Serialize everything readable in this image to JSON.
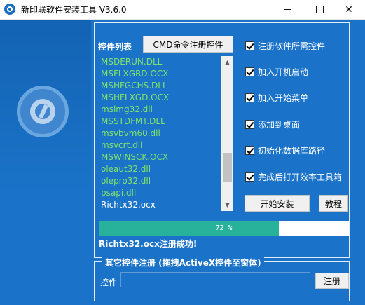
{
  "window": {
    "title": "新印联软件安装工具 V3.6.0",
    "min_icon": "minimize-icon",
    "max_icon": "maximize-icon",
    "close_icon": "close-icon"
  },
  "colors": {
    "panel_bg": "#1a73c8",
    "pending_item": "#7fe36a",
    "done_item": "#ffffff",
    "progress_fill": "#28b29c"
  },
  "controls_list": {
    "header": "控件列表",
    "cmd_button": "CMD命令注册控件",
    "items": [
      {
        "name": "MSDERUN.DLL",
        "done": false
      },
      {
        "name": "MSFLXGRD.OCX",
        "done": false
      },
      {
        "name": "MSHFGCHS.DLL",
        "done": false
      },
      {
        "name": "MSHFLXGD.OCX",
        "done": false
      },
      {
        "name": "msimg32.dll",
        "done": false
      },
      {
        "name": "MSSTDFMT.DLL",
        "done": false
      },
      {
        "name": "msvbvm60.dll",
        "done": false
      },
      {
        "name": "msvcrt.dll",
        "done": false
      },
      {
        "name": "MSWINSCK.OCX",
        "done": false
      },
      {
        "name": "oleaut32.dll",
        "done": false
      },
      {
        "name": "olepro32.dll",
        "done": false
      },
      {
        "name": "psapi.dll",
        "done": false
      },
      {
        "name": "Richtx32.ocx",
        "done": true
      }
    ]
  },
  "options": [
    {
      "label": "注册软件所需控件",
      "checked": true
    },
    {
      "label": "加入开机启动",
      "checked": true
    },
    {
      "label": "加入开始菜单",
      "checked": true
    },
    {
      "label": "添加到桌面",
      "checked": true
    },
    {
      "label": "初始化数据库路径",
      "checked": true
    },
    {
      "label": "完成后打开效率工具箱",
      "checked": true
    }
  ],
  "buttons": {
    "install": "开始安装",
    "tutorial": "教程"
  },
  "progress": {
    "value": 0.72,
    "text": "72 %"
  },
  "status": "Richtx32.ocx注册成功!",
  "other_register": {
    "title": "其它控件注册 (拖拽ActiveX控件至窗体)",
    "label": "控件",
    "input_value": "",
    "button": "注册"
  }
}
